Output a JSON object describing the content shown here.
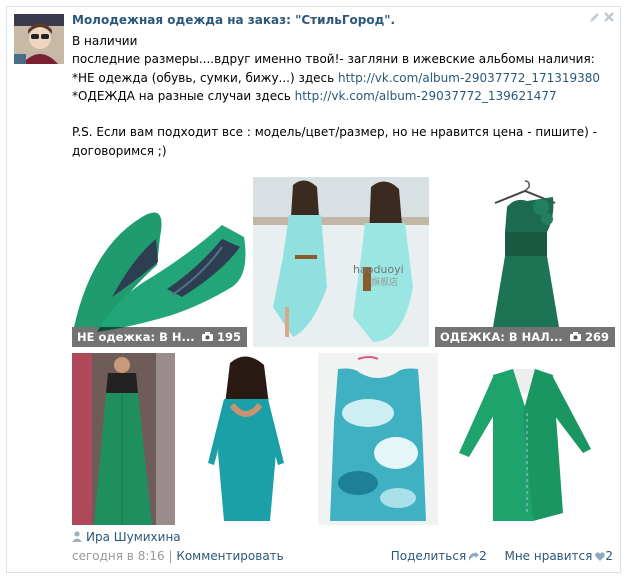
{
  "post": {
    "group_title": "Молодежная одежда на заказ: \"СтильГород\".",
    "lines": {
      "l1": "В наличии",
      "l2": "последние размеры....вдруг именно твой!- загляни в ижевские альбомы наличия:",
      "l3_text": "*НЕ одежда (обувь, сумки, бижу...) здесь ",
      "l3_link": "http://vk.com/album-29037772_171319380",
      "l4_text": "*ОДЕЖДА на разные случаи здесь ",
      "l4_link": "http://vk.com/album-29037772_139621477",
      "l5": "P.S. Если вам подходит все : модель/цвет/размер, но не нравится цена - пишите) -",
      "l6": "договоримся ;)"
    },
    "albums": [
      {
        "title": "НЕ одежка: В Н...",
        "count": "195"
      },
      {
        "title": "ОДЕЖКА: В НАЛ...",
        "count": "269"
      }
    ],
    "watermark": {
      "brand": "haoduoyi",
      "sub": "旗舰店"
    },
    "author": "Ира Шумихина",
    "date": "сегодня в 8:16",
    "separator": " | ",
    "comment": "Комментировать",
    "share": {
      "label": "Поделиться",
      "count": "2"
    },
    "like": {
      "label": "Мне нравится",
      "count": "2"
    }
  },
  "colors": {
    "link": "#2b587a",
    "accent_green": "#1fa071",
    "border": "#dae1e8"
  },
  "icons": [
    "avatar",
    "edit-icon",
    "close-icon",
    "camera-icon",
    "user-icon",
    "share-icon",
    "heart-icon"
  ]
}
